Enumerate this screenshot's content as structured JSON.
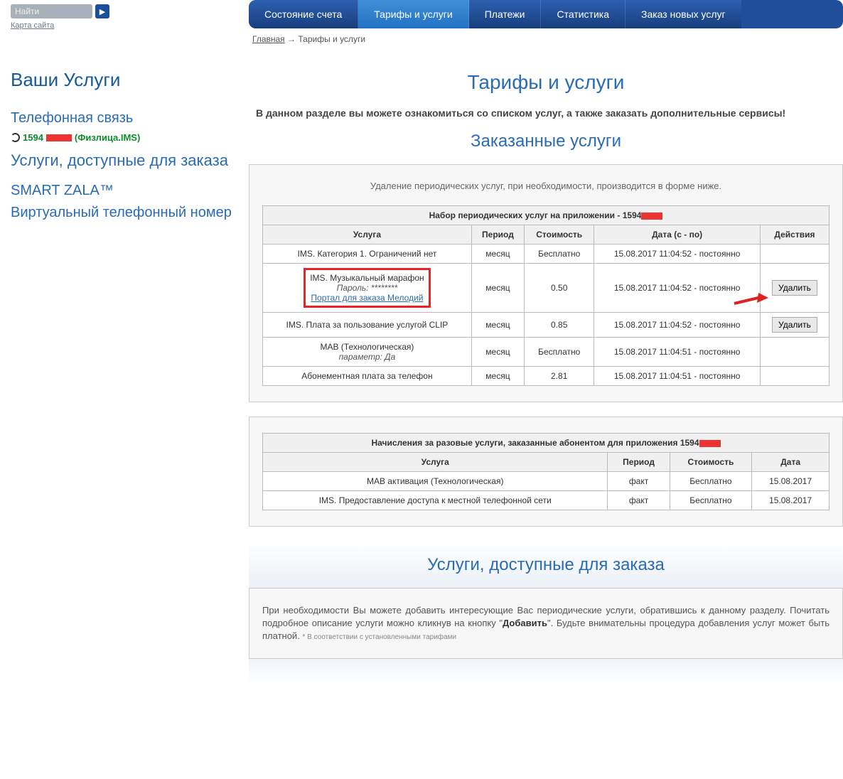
{
  "search": {
    "placeholder": "Найти",
    "sitemap": "Карта сайта"
  },
  "sidebar": {
    "heading": "Ваши Услуги",
    "telephony": "Телефонная связь",
    "phone_prefix": "1594",
    "phone_suffix": "(Физлица.IMS)",
    "avail": "Услуги, доступные для заказа",
    "smart": "SMART ZALA™",
    "virtual": "Виртуальный телефонный номер"
  },
  "nav": {
    "items": [
      {
        "label": "Состояние счета"
      },
      {
        "label": "Тарифы и услуги"
      },
      {
        "label": "Платежи"
      },
      {
        "label": "Статистика"
      },
      {
        "label": "Заказ новых услуг"
      }
    ],
    "active_index": 1
  },
  "breadcrumb": {
    "home": "Главная",
    "sep": " → ",
    "current": "Тарифы и услуги"
  },
  "page_title": "Тарифы и услуги",
  "intro": "В данном разделе вы можете ознакомиться со списком услуг, а также заказать дополнительные сервисы!",
  "ordered": {
    "title": "Заказанные услуги",
    "note": "Удаление периодических услуг, при необходимости, производится в форме ниже.",
    "caption_prefix": "Набор периодических услуг на приложении - 1594",
    "columns": {
      "service": "Услуга",
      "period": "Период",
      "cost": "Стоимость",
      "date": "Дата (с - по)",
      "actions": "Действия"
    },
    "delete_label": "Удалить",
    "rows": [
      {
        "name": "IMS. Категория 1. Ограничений нет",
        "sub": "",
        "link": "",
        "period": "месяц",
        "cost": "Бесплатно",
        "date": "15.08.2017 11:04:52 - постоянно",
        "deletable": false,
        "highlight": false
      },
      {
        "name": "IMS. Музыкальный марафон",
        "sub": "Пароль: ********",
        "link": "Портал для заказа Мелодий",
        "period": "месяц",
        "cost": "0.50",
        "date": "15.08.2017 11:04:52 - постоянно",
        "deletable": true,
        "highlight": true,
        "arrow": true
      },
      {
        "name": "IMS. Плата за пользование услугой CLIP",
        "sub": "",
        "link": "",
        "period": "месяц",
        "cost": "0.85",
        "date": "15.08.2017 11:04:52 - постоянно",
        "deletable": true,
        "highlight": false
      },
      {
        "name": "МАВ (Технологическая)",
        "sub": "параметр: Да",
        "link": "",
        "period": "месяц",
        "cost": "Бесплатно",
        "date": "15.08.2017 11:04:51 - постоянно",
        "deletable": false,
        "highlight": false
      },
      {
        "name": "Абонементная плата за телефон",
        "sub": "",
        "link": "",
        "period": "месяц",
        "cost": "2.81",
        "date": "15.08.2017 11:04:51 - постоянно",
        "deletable": false,
        "highlight": false
      }
    ]
  },
  "onetime": {
    "caption_prefix": "Начисления за разовые услуги, заказанные абонентом для приложения 1594",
    "columns": {
      "service": "Услуга",
      "period": "Период",
      "cost": "Стоимость",
      "date": "Дата"
    },
    "rows": [
      {
        "name": "МАВ активация (Технологическая)",
        "period": "факт",
        "cost": "Бесплатно",
        "date": "15.08.2017"
      },
      {
        "name": "IMS. Предоставление доступа к местной телефонной сети",
        "period": "факт",
        "cost": "Бесплатно",
        "date": "15.08.2017"
      }
    ]
  },
  "available": {
    "title": "Услуги, доступные для заказа",
    "note_pre": "При необходимости Вы можете добавить интересующие Вас периодические услуги, обратившись к данному разделу. Почитать подробное описание услуги можно кликнув на кнопку \"",
    "note_bold": "Добавить",
    "note_post": "\". Будьте внимательны процедура добавления услуг может быть платной. ",
    "note_fine": "* В соответствии с установленными тарифами"
  }
}
